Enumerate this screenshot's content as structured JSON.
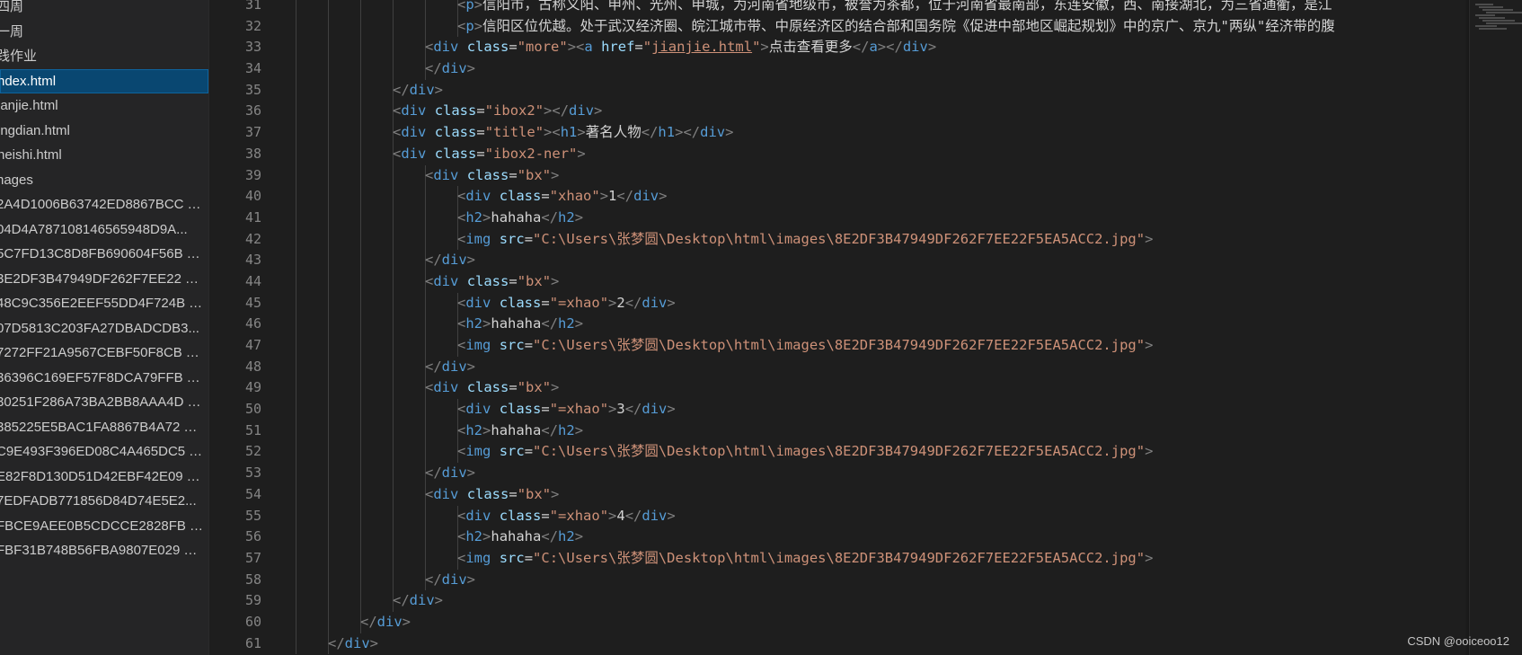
{
  "explorer": {
    "items": [
      {
        "label": "四周",
        "kind": "folder"
      },
      {
        "label": "一周",
        "kind": "folder"
      },
      {
        "label": "践作业",
        "kind": "folder"
      },
      {
        "label": "ndex.html",
        "kind": "file",
        "active": true
      },
      {
        "label": "ianjie.html",
        "kind": "file"
      },
      {
        "label": "ingdian.html",
        "kind": "file"
      },
      {
        "label": "neishi.html",
        "kind": "file"
      },
      {
        "label": "nages",
        "kind": "folder"
      },
      {
        "label": "2A4D1006B63742ED8867BCC1...",
        "kind": "image"
      },
      {
        "label": "04D4A787108146565948D9A...",
        "kind": "image"
      },
      {
        "label": "5C7FD13C8D8FB690604F56B39...",
        "kind": "image"
      },
      {
        "label": "3E2DF3B47949DF262F7EE22F5...",
        "kind": "image"
      },
      {
        "label": "48C9C356E2EEF55DD4F724B8A...",
        "kind": "image"
      },
      {
        "label": "07D5813C203FA27DBADCDB3...",
        "kind": "image"
      },
      {
        "label": "7272FF21A9567CEBF50F8CBB0...",
        "kind": "image"
      },
      {
        "label": "36396C169EF57F8DCA79FFB44...",
        "kind": "image"
      },
      {
        "label": "30251F286A73BA2BB8AAA4DE...",
        "kind": "image"
      },
      {
        "label": "385225E5BAC1FA8867B4A7203...",
        "kind": "image"
      },
      {
        "label": "C9E493F396ED08C4A465DC59...",
        "kind": "image"
      },
      {
        "label": "E82F8D130D51D42EBF42E09F...",
        "kind": "image"
      },
      {
        "label": "7EDFADB771856D84D74E5E2...",
        "kind": "image"
      },
      {
        "label": "FBCE9AEE0B5CDCCE2828FBBA...",
        "kind": "image"
      },
      {
        "label": "FBF31B748B56FBA9807E0293F...",
        "kind": "image"
      }
    ]
  },
  "editor": {
    "line_numbers": [
      "31",
      "32",
      "33",
      "34",
      "35",
      "36",
      "37",
      "38",
      "39",
      "40",
      "41",
      "42",
      "43",
      "44",
      "45",
      "46",
      "47",
      "48",
      "49",
      "50",
      "51",
      "52",
      "53",
      "54",
      "55",
      "56",
      "57",
      "58",
      "59",
      "60",
      "61"
    ],
    "lines": [
      {
        "indent": 7,
        "tokens": [
          [
            "punc",
            "<"
          ],
          [
            "tag",
            "p"
          ],
          [
            "punc",
            ">"
          ],
          [
            "txt",
            "信阳市，古称义阳、申州、光州、申城，为河南省地级市，被誉为茶都，位于河南省最南部，东连安徽，西、南接湖北，为三省通衢，是江"
          ]
        ]
      },
      {
        "indent": 7,
        "tokens": [
          [
            "punc",
            "<"
          ],
          [
            "tag",
            "p"
          ],
          [
            "punc",
            ">"
          ],
          [
            "txt",
            "信阳区位优越。处于武汉经济圈、皖江城市带、中原经济区的结合部和国务院《促进中部地区崛起规划》中的京广、京九\"两纵\"经济带的腹"
          ]
        ]
      },
      {
        "indent": 6,
        "tokens": [
          [
            "punc",
            "<"
          ],
          [
            "tag",
            "div"
          ],
          [
            "txt",
            " "
          ],
          [
            "attr",
            "class"
          ],
          [
            "txt",
            "="
          ],
          [
            "str",
            "\"more\""
          ],
          [
            "punc",
            ">"
          ],
          [
            "punc",
            "<"
          ],
          [
            "tag",
            "a"
          ],
          [
            "txt",
            " "
          ],
          [
            "attr",
            "href"
          ],
          [
            "txt",
            "="
          ],
          [
            "str",
            "\""
          ],
          [
            "str-link",
            "jianjie.html"
          ],
          [
            "str",
            "\""
          ],
          [
            "punc",
            ">"
          ],
          [
            "txt",
            "点击查看更多"
          ],
          [
            "punc",
            "</"
          ],
          [
            "tag",
            "a"
          ],
          [
            "punc",
            ">"
          ],
          [
            "punc",
            "</"
          ],
          [
            "tag",
            "div"
          ],
          [
            "punc",
            ">"
          ]
        ]
      },
      {
        "indent": 6,
        "tokens": [
          [
            "punc",
            "</"
          ],
          [
            "tag",
            "div"
          ],
          [
            "punc",
            ">"
          ]
        ]
      },
      {
        "indent": 5,
        "tokens": [
          [
            "punc",
            "</"
          ],
          [
            "tag",
            "div"
          ],
          [
            "punc",
            ">"
          ]
        ]
      },
      {
        "indent": 5,
        "tokens": [
          [
            "punc",
            "<"
          ],
          [
            "tag",
            "div"
          ],
          [
            "txt",
            " "
          ],
          [
            "attr",
            "class"
          ],
          [
            "txt",
            "="
          ],
          [
            "str",
            "\"ibox2\""
          ],
          [
            "punc",
            ">"
          ],
          [
            "punc",
            "</"
          ],
          [
            "tag",
            "div"
          ],
          [
            "punc",
            ">"
          ]
        ]
      },
      {
        "indent": 5,
        "tokens": [
          [
            "punc",
            "<"
          ],
          [
            "tag",
            "div"
          ],
          [
            "txt",
            " "
          ],
          [
            "attr",
            "class"
          ],
          [
            "txt",
            "="
          ],
          [
            "str",
            "\"title\""
          ],
          [
            "punc",
            ">"
          ],
          [
            "punc",
            "<"
          ],
          [
            "tag",
            "h1"
          ],
          [
            "punc",
            ">"
          ],
          [
            "txt",
            "著名人物"
          ],
          [
            "punc",
            "</"
          ],
          [
            "tag",
            "h1"
          ],
          [
            "punc",
            ">"
          ],
          [
            "punc",
            "</"
          ],
          [
            "tag",
            "div"
          ],
          [
            "punc",
            ">"
          ]
        ]
      },
      {
        "indent": 5,
        "tokens": [
          [
            "punc",
            "<"
          ],
          [
            "tag",
            "div"
          ],
          [
            "txt",
            " "
          ],
          [
            "attr",
            "class"
          ],
          [
            "txt",
            "="
          ],
          [
            "str",
            "\"ibox2-ner\""
          ],
          [
            "punc",
            ">"
          ]
        ]
      },
      {
        "indent": 6,
        "tokens": [
          [
            "punc",
            "<"
          ],
          [
            "tag",
            "div"
          ],
          [
            "txt",
            " "
          ],
          [
            "attr",
            "class"
          ],
          [
            "txt",
            "="
          ],
          [
            "str",
            "\"bx\""
          ],
          [
            "punc",
            ">"
          ]
        ]
      },
      {
        "indent": 7,
        "tokens": [
          [
            "punc",
            "<"
          ],
          [
            "tag",
            "div"
          ],
          [
            "txt",
            " "
          ],
          [
            "attr",
            "class"
          ],
          [
            "txt",
            "="
          ],
          [
            "str",
            "\"xhao\""
          ],
          [
            "punc",
            ">"
          ],
          [
            "txt",
            "1"
          ],
          [
            "punc",
            "</"
          ],
          [
            "tag",
            "div"
          ],
          [
            "punc",
            ">"
          ]
        ]
      },
      {
        "indent": 7,
        "tokens": [
          [
            "punc",
            "<"
          ],
          [
            "tag",
            "h2"
          ],
          [
            "punc",
            ">"
          ],
          [
            "txt",
            "hahaha"
          ],
          [
            "punc",
            "</"
          ],
          [
            "tag",
            "h2"
          ],
          [
            "punc",
            ">"
          ]
        ]
      },
      {
        "indent": 7,
        "tokens": [
          [
            "punc",
            "<"
          ],
          [
            "tag",
            "img"
          ],
          [
            "txt",
            " "
          ],
          [
            "attr",
            "src"
          ],
          [
            "txt",
            "="
          ],
          [
            "str",
            "\"C:\\Users\\张梦圆\\Desktop\\html\\images\\8E2DF3B47949DF262F7EE22F5EA5ACC2.jpg\""
          ],
          [
            "punc",
            ">"
          ]
        ]
      },
      {
        "indent": 6,
        "tokens": [
          [
            "punc",
            "</"
          ],
          [
            "tag",
            "div"
          ],
          [
            "punc",
            ">"
          ]
        ]
      },
      {
        "indent": 6,
        "tokens": [
          [
            "punc",
            "<"
          ],
          [
            "tag",
            "div"
          ],
          [
            "txt",
            " "
          ],
          [
            "attr",
            "class"
          ],
          [
            "txt",
            "="
          ],
          [
            "str",
            "\"bx\""
          ],
          [
            "punc",
            ">"
          ]
        ]
      },
      {
        "indent": 7,
        "tokens": [
          [
            "punc",
            "<"
          ],
          [
            "tag",
            "div"
          ],
          [
            "txt",
            " "
          ],
          [
            "attr",
            "class"
          ],
          [
            "txt",
            "="
          ],
          [
            "str",
            "\"=xhao\""
          ],
          [
            "punc",
            ">"
          ],
          [
            "txt",
            "2"
          ],
          [
            "punc",
            "</"
          ],
          [
            "tag",
            "div"
          ],
          [
            "punc",
            ">"
          ]
        ]
      },
      {
        "indent": 7,
        "tokens": [
          [
            "punc",
            "<"
          ],
          [
            "tag",
            "h2"
          ],
          [
            "punc",
            ">"
          ],
          [
            "txt",
            "hahaha"
          ],
          [
            "punc",
            "</"
          ],
          [
            "tag",
            "h2"
          ],
          [
            "punc",
            ">"
          ]
        ]
      },
      {
        "indent": 7,
        "tokens": [
          [
            "punc",
            "<"
          ],
          [
            "tag",
            "img"
          ],
          [
            "txt",
            " "
          ],
          [
            "attr",
            "src"
          ],
          [
            "txt",
            "="
          ],
          [
            "str",
            "\"C:\\Users\\张梦圆\\Desktop\\html\\images\\8E2DF3B47949DF262F7EE22F5EA5ACC2.jpg\""
          ],
          [
            "punc",
            ">"
          ]
        ]
      },
      {
        "indent": 6,
        "tokens": [
          [
            "punc",
            "</"
          ],
          [
            "tag",
            "div"
          ],
          [
            "punc",
            ">"
          ]
        ]
      },
      {
        "indent": 6,
        "tokens": [
          [
            "punc",
            "<"
          ],
          [
            "tag",
            "div"
          ],
          [
            "txt",
            " "
          ],
          [
            "attr",
            "class"
          ],
          [
            "txt",
            "="
          ],
          [
            "str",
            "\"bx\""
          ],
          [
            "punc",
            ">"
          ]
        ]
      },
      {
        "indent": 7,
        "tokens": [
          [
            "punc",
            "<"
          ],
          [
            "tag",
            "div"
          ],
          [
            "txt",
            " "
          ],
          [
            "attr",
            "class"
          ],
          [
            "txt",
            "="
          ],
          [
            "str",
            "\"=xhao\""
          ],
          [
            "punc",
            ">"
          ],
          [
            "txt",
            "3"
          ],
          [
            "punc",
            "</"
          ],
          [
            "tag",
            "div"
          ],
          [
            "punc",
            ">"
          ]
        ]
      },
      {
        "indent": 7,
        "tokens": [
          [
            "punc",
            "<"
          ],
          [
            "tag",
            "h2"
          ],
          [
            "punc",
            ">"
          ],
          [
            "txt",
            "hahaha"
          ],
          [
            "punc",
            "</"
          ],
          [
            "tag",
            "h2"
          ],
          [
            "punc",
            ">"
          ]
        ]
      },
      {
        "indent": 7,
        "tokens": [
          [
            "punc",
            "<"
          ],
          [
            "tag",
            "img"
          ],
          [
            "txt",
            " "
          ],
          [
            "attr",
            "src"
          ],
          [
            "txt",
            "="
          ],
          [
            "str",
            "\"C:\\Users\\张梦圆\\Desktop\\html\\images\\8E2DF3B47949DF262F7EE22F5EA5ACC2.jpg\""
          ],
          [
            "punc",
            ">"
          ]
        ]
      },
      {
        "indent": 6,
        "tokens": [
          [
            "punc",
            "</"
          ],
          [
            "tag",
            "div"
          ],
          [
            "punc",
            ">"
          ]
        ]
      },
      {
        "indent": 6,
        "tokens": [
          [
            "punc",
            "<"
          ],
          [
            "tag",
            "div"
          ],
          [
            "txt",
            " "
          ],
          [
            "attr",
            "class"
          ],
          [
            "txt",
            "="
          ],
          [
            "str",
            "\"bx\""
          ],
          [
            "punc",
            ">"
          ]
        ]
      },
      {
        "indent": 7,
        "tokens": [
          [
            "punc",
            "<"
          ],
          [
            "tag",
            "div"
          ],
          [
            "txt",
            " "
          ],
          [
            "attr",
            "class"
          ],
          [
            "txt",
            "="
          ],
          [
            "str",
            "\"=xhao\""
          ],
          [
            "punc",
            ">"
          ],
          [
            "txt",
            "4"
          ],
          [
            "punc",
            "</"
          ],
          [
            "tag",
            "div"
          ],
          [
            "punc",
            ">"
          ]
        ]
      },
      {
        "indent": 7,
        "tokens": [
          [
            "punc",
            "<"
          ],
          [
            "tag",
            "h2"
          ],
          [
            "punc",
            ">"
          ],
          [
            "txt",
            "hahaha"
          ],
          [
            "punc",
            "</"
          ],
          [
            "tag",
            "h2"
          ],
          [
            "punc",
            ">"
          ]
        ]
      },
      {
        "indent": 7,
        "tokens": [
          [
            "punc",
            "<"
          ],
          [
            "tag",
            "img"
          ],
          [
            "txt",
            " "
          ],
          [
            "attr",
            "src"
          ],
          [
            "txt",
            "="
          ],
          [
            "str",
            "\"C:\\Users\\张梦圆\\Desktop\\html\\images\\8E2DF3B47949DF262F7EE22F5EA5ACC2.jpg\""
          ],
          [
            "punc",
            ">"
          ]
        ]
      },
      {
        "indent": 6,
        "tokens": [
          [
            "punc",
            "</"
          ],
          [
            "tag",
            "div"
          ],
          [
            "punc",
            ">"
          ]
        ]
      },
      {
        "indent": 5,
        "tokens": [
          [
            "punc",
            "</"
          ],
          [
            "tag",
            "div"
          ],
          [
            "punc",
            ">"
          ]
        ]
      },
      {
        "indent": 4,
        "tokens": [
          [
            "punc",
            "</"
          ],
          [
            "tag",
            "div"
          ],
          [
            "punc",
            ">"
          ]
        ]
      },
      {
        "indent": 3,
        "tokens": [
          [
            "punc",
            "</"
          ],
          [
            "tag",
            "div"
          ],
          [
            "punc",
            ">"
          ]
        ]
      }
    ]
  },
  "watermark": "CSDN @ooiceoo12",
  "colors": {
    "background": "#1e1e1e",
    "sidebar": "#252526",
    "selection": "#094771",
    "tag": "#569cd6",
    "attribute": "#9cdcfe",
    "string": "#ce9178",
    "text": "#d4d4d4",
    "line_number": "#858585"
  }
}
